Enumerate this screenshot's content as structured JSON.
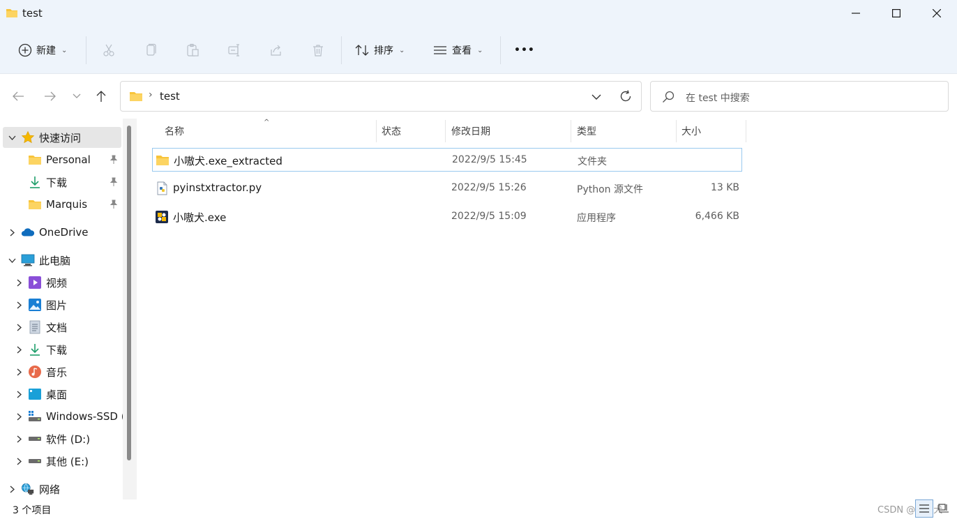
{
  "window": {
    "title": "test"
  },
  "commandbar": {
    "new_label": "新建",
    "sort_label": "排序",
    "view_label": "查看",
    "more_label": "•••"
  },
  "nav": {
    "address_path": "test",
    "search_placeholder": "在 test 中搜索"
  },
  "sidebar": {
    "quick_access": "快速访问",
    "quick_items": [
      "Personal",
      "下载",
      "Marquis"
    ],
    "onedrive": "OneDrive",
    "this_pc": "此电脑",
    "pc_items": [
      "视频",
      "图片",
      "文档",
      "下载",
      "音乐",
      "桌面",
      "Windows-SSD (",
      "软件 (D:)",
      "其他 (E:)"
    ],
    "network": "网络"
  },
  "columns": {
    "name": "名称",
    "status": "状态",
    "modified": "修改日期",
    "type": "类型",
    "size": "大小"
  },
  "files": [
    {
      "name": "小嗷犬.exe_extracted",
      "modified": "2022/9/5 15:45",
      "type": "文件夹",
      "size": "",
      "icon": "folder-icon"
    },
    {
      "name": "pyinstxtractor.py",
      "modified": "2022/9/5 15:26",
      "type": "Python 源文件",
      "size": "13 KB",
      "icon": "python-file-icon"
    },
    {
      "name": "小嗷犬.exe",
      "modified": "2022/9/5 15:09",
      "type": "应用程序",
      "size": "6,466 KB",
      "icon": "exe-icon"
    }
  ],
  "status": {
    "count": "3 个项目",
    "watermark": "CSDN @小嗷犬"
  },
  "colors": {
    "topbar_bg": "#eef4fb",
    "selection_border": "#99c9ef",
    "folder_yellow": "#f8c43a",
    "accent_blue": "#0067c0"
  }
}
